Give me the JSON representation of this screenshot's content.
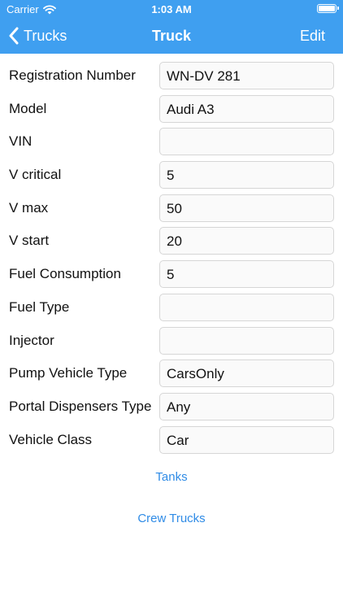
{
  "status_bar": {
    "carrier": "Carrier",
    "time": "1:03 AM"
  },
  "nav": {
    "back_label": "Trucks",
    "title": "Truck",
    "edit_label": "Edit"
  },
  "fields": [
    {
      "label": "Registration Number",
      "value": "WN-DV 281"
    },
    {
      "label": "Model",
      "value": "Audi A3"
    },
    {
      "label": "VIN",
      "value": ""
    },
    {
      "label": "V critical",
      "value": "5"
    },
    {
      "label": "V max",
      "value": "50"
    },
    {
      "label": "V start",
      "value": "20"
    },
    {
      "label": "Fuel Consumption",
      "value": "5"
    },
    {
      "label": "Fuel Type",
      "value": ""
    },
    {
      "label": "Injector",
      "value": ""
    },
    {
      "label": "Pump Vehicle Type",
      "value": "CarsOnly"
    },
    {
      "label": "Portal Dispensers Type",
      "value": "Any"
    },
    {
      "label": "Vehicle Class",
      "value": "Car"
    }
  ],
  "links": {
    "tanks": "Tanks",
    "crew_trucks": "Crew Trucks"
  },
  "colors": {
    "nav_background": "#3f9ff0",
    "link": "#2f8be6"
  },
  "icons": {
    "wifi": "wifi-icon",
    "battery": "battery-icon",
    "back": "chevron-left-icon"
  }
}
